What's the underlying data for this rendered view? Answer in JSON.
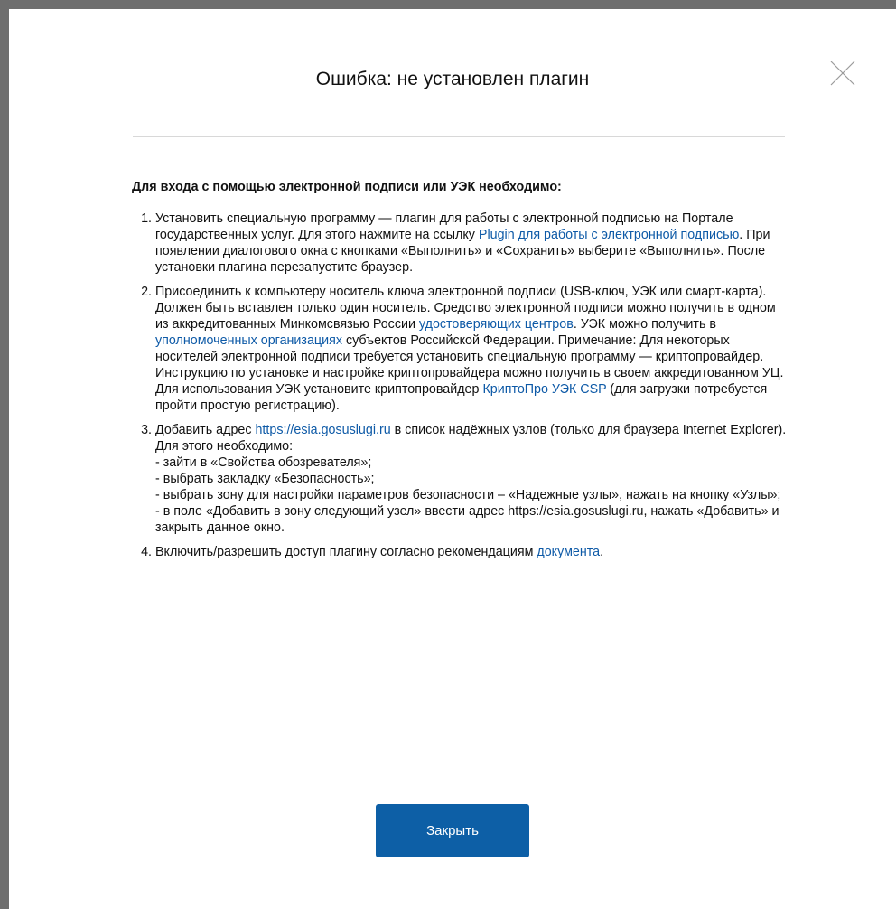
{
  "dialog": {
    "title": "Ошибка: не установлен плагин",
    "close_icon": "close-icon",
    "lead": "Для входа с помощью электронной подписи или УЭК необходимо:",
    "steps": [
      {
        "t1": "Установить специальную программу — плагин для работы с электронной подписью на Портале государственных услуг. Для этого нажмите на ссылку ",
        "link1": "Plugin для работы с электронной подписью",
        "t2": ". При появлении диалогового окна с кнопками «Выполнить» и «Сохранить» выберите «Выполнить». После установки плагина перезапустите браузер."
      },
      {
        "t1": "Присоединить к компьютеру носитель ключа электронной подписи (USB-ключ, УЭК или смарт-карта). Должен быть вставлен только один носитель. Средство электронной подписи можно получить в одном из аккредитованных Минкомсвязью России ",
        "link1": "удостоверяющих центров",
        "t2": ". УЭК можно получить в ",
        "link2": "уполномоченных организациях",
        "t3": " субъектов Российской Федерации. Примечание: Для некоторых носителей электронной подписи требуется установить специальную программу — криптопровайдер. Инструкцию по установке и настройке криптопровайдера можно получить в своем аккредитованном УЦ. Для использования УЭК установите криптопровайдер ",
        "link3": "КриптоПро УЭК CSP",
        "t4": " (для загрузки потребуется пройти простую регистрацию)."
      },
      {
        "t1": "Добавить адрес ",
        "link1": "https://esia.gosuslugi.ru",
        "t2": " в список надёжных узлов (только для браузера Internet Explorer). Для этого необходимо:",
        "lines": [
          "- зайти в «Свойства обозревателя»;",
          "- выбрать закладку «Безопасность»;",
          "- выбрать зону для настройки параметров безопасности – «Надежные узлы», нажать на кнопку «Узлы»;",
          "- в поле «Добавить в зону следующий узел» ввести адрес https://esia.gosuslugi.ru, нажать «Добавить» и закрыть данное окно."
        ]
      },
      {
        "t1": "Включить/разрешить доступ плагину согласно рекомендациям ",
        "link1": "документа",
        "t2": "."
      }
    ],
    "close_button_label": "Закрыть",
    "link_color": "#0e5aa7",
    "button_color": "#0d5fa6"
  }
}
